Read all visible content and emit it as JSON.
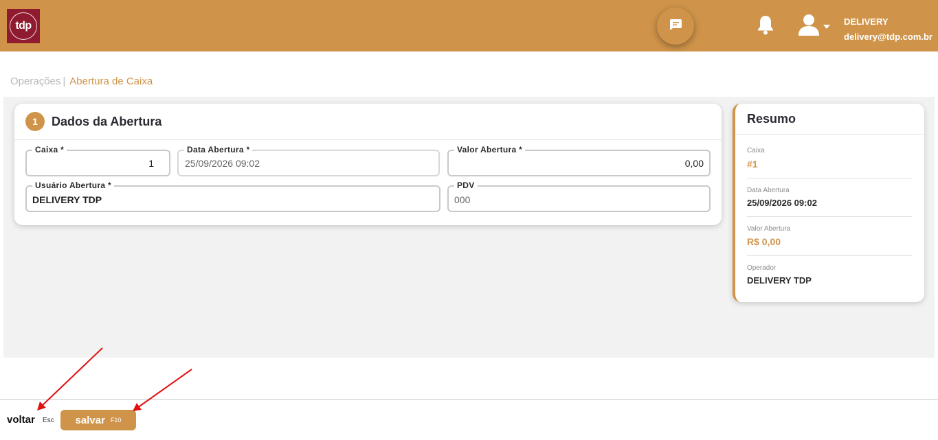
{
  "header": {
    "logo_text": "tdp",
    "user_name": "DELIVERY",
    "user_email": "delivery@tdp.com.br",
    "accent_color": "#cf9449"
  },
  "breadcrumb": {
    "root": "Operações",
    "separator": "|",
    "current": "Abertura de Caixa"
  },
  "form": {
    "step": "1",
    "title": "Dados da Abertura",
    "fields": {
      "caixa": {
        "label": "Caixa *",
        "value": "1"
      },
      "data_abertura": {
        "label": "Data Abertura *",
        "value": "25/09/2026 09:02"
      },
      "valor_abertura": {
        "label": "Valor Abertura *",
        "value": "0,00"
      },
      "usuario_abertura": {
        "label": "Usuário Abertura *",
        "value": "DELIVERY TDP"
      },
      "pdv": {
        "label": "PDV",
        "value": "000"
      }
    }
  },
  "summary": {
    "title": "Resumo",
    "items": [
      {
        "label": "Caixa",
        "value": "#1"
      },
      {
        "label": "Data Abertura",
        "value": "25/09/2026 09:02"
      },
      {
        "label": "Valor Abertura",
        "value": "R$ 0,00"
      },
      {
        "label": "Operador",
        "value": "DELIVERY TDP"
      }
    ]
  },
  "footer": {
    "back_label": "voltar",
    "back_key": "Esc",
    "save_label": "salvar",
    "save_key": "F10"
  }
}
